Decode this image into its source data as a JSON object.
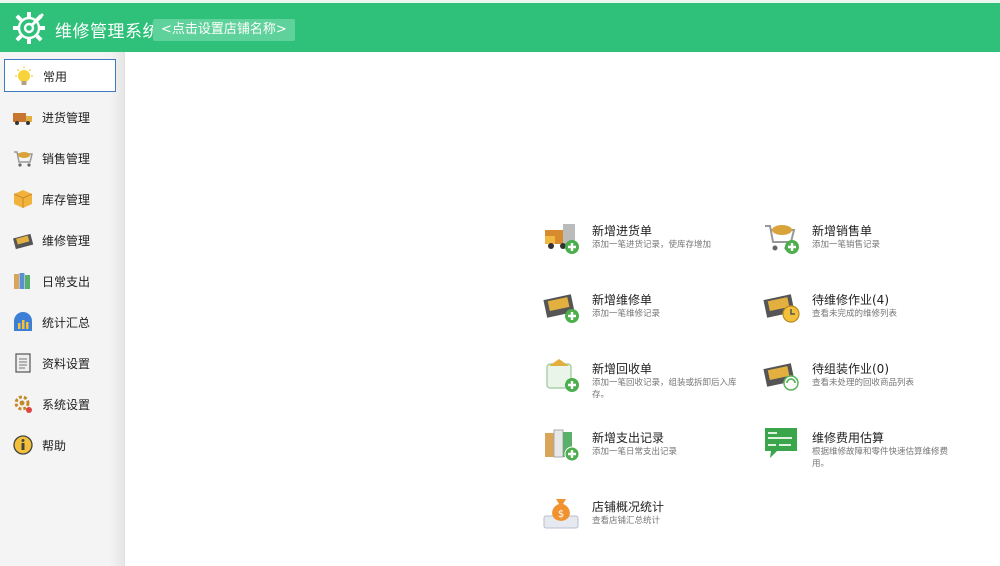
{
  "header": {
    "title": "维修管理系统",
    "shop_name": "<点击设置店铺名称>",
    "bg_color": "#2fc07a"
  },
  "sidebar": {
    "items": [
      {
        "label": "常用",
        "icon": "lightbulb-icon",
        "active": true
      },
      {
        "label": "进货管理",
        "icon": "truck-icon"
      },
      {
        "label": "销售管理",
        "icon": "shopping-cart-icon"
      },
      {
        "label": "库存管理",
        "icon": "box-icon"
      },
      {
        "label": "维修管理",
        "icon": "toolbox-icon"
      },
      {
        "label": "日常支出",
        "icon": "binders-icon"
      },
      {
        "label": "统计汇总",
        "icon": "chart-icon"
      },
      {
        "label": "资料设置",
        "icon": "document-icon"
      },
      {
        "label": "系统设置",
        "icon": "gear-icon"
      },
      {
        "label": "帮助",
        "icon": "help-icon"
      }
    ]
  },
  "actions": [
    {
      "title": "新增进货单",
      "desc": "添加一笔进货记录，使库存增加",
      "icon": "truck-add-icon"
    },
    {
      "title": "新增销售单",
      "desc": "添加一笔销售记录",
      "icon": "cart-add-icon"
    },
    {
      "title": "新增维修单",
      "desc": "添加一笔维修记录",
      "icon": "toolbox-add-icon"
    },
    {
      "title": "待维修作业(4)",
      "desc": "查看未完成的维修列表",
      "icon": "toolbox-clock-icon"
    },
    {
      "title": "新增回收单",
      "desc": "添加一笔回收记录，组装或拆卸后入库存。",
      "icon": "recycle-add-icon"
    },
    {
      "title": "待组装作业(0)",
      "desc": "查看未处理的回收商品列表",
      "icon": "toolbox-recycle-icon"
    },
    {
      "title": "新增支出记录",
      "desc": "添加一笔日常支出记录",
      "icon": "binders-add-icon"
    },
    {
      "title": "维修费用估算",
      "desc": "根据维修故障和零件快速估算维修费用。",
      "icon": "chat-estimate-icon"
    },
    {
      "title": "店铺概况统计",
      "desc": "查看店铺汇总统计",
      "icon": "money-bag-icon"
    }
  ]
}
